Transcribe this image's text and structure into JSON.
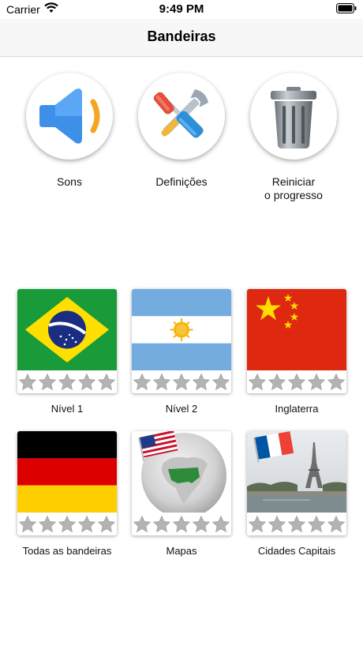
{
  "status_bar": {
    "carrier": "Carrier",
    "time": "9:49 PM"
  },
  "nav": {
    "title": "Bandeiras"
  },
  "actions": [
    {
      "label": "Sons",
      "icon": "speaker-icon"
    },
    {
      "label": "Definições",
      "icon": "tools-icon"
    },
    {
      "label_line1": "Reiniciar",
      "label_line2": "o progresso",
      "icon": "trash-icon"
    }
  ],
  "cards": [
    {
      "label": "Nível 1",
      "image": "brazil-flag",
      "stars_filled": 0,
      "stars_total": 5
    },
    {
      "label": "Nível 2",
      "image": "argentina-flag",
      "stars_filled": 0,
      "stars_total": 5
    },
    {
      "label": "Inglaterra",
      "image": "china-flag",
      "stars_filled": 0,
      "stars_total": 5
    },
    {
      "label": "Todas as bandeiras",
      "image": "germany-flag",
      "stars_filled": 0,
      "stars_total": 5
    },
    {
      "label": "Mapas",
      "image": "globe-usa-map",
      "stars_filled": 0,
      "stars_total": 5
    },
    {
      "label": "Cidades Capitais",
      "image": "paris-eiffel-tower",
      "stars_filled": 0,
      "stars_total": 5
    }
  ],
  "colors": {
    "star": "#b3b3b3",
    "speaker_blue": "#3d8fe8",
    "speaker_orange": "#f5a623"
  }
}
